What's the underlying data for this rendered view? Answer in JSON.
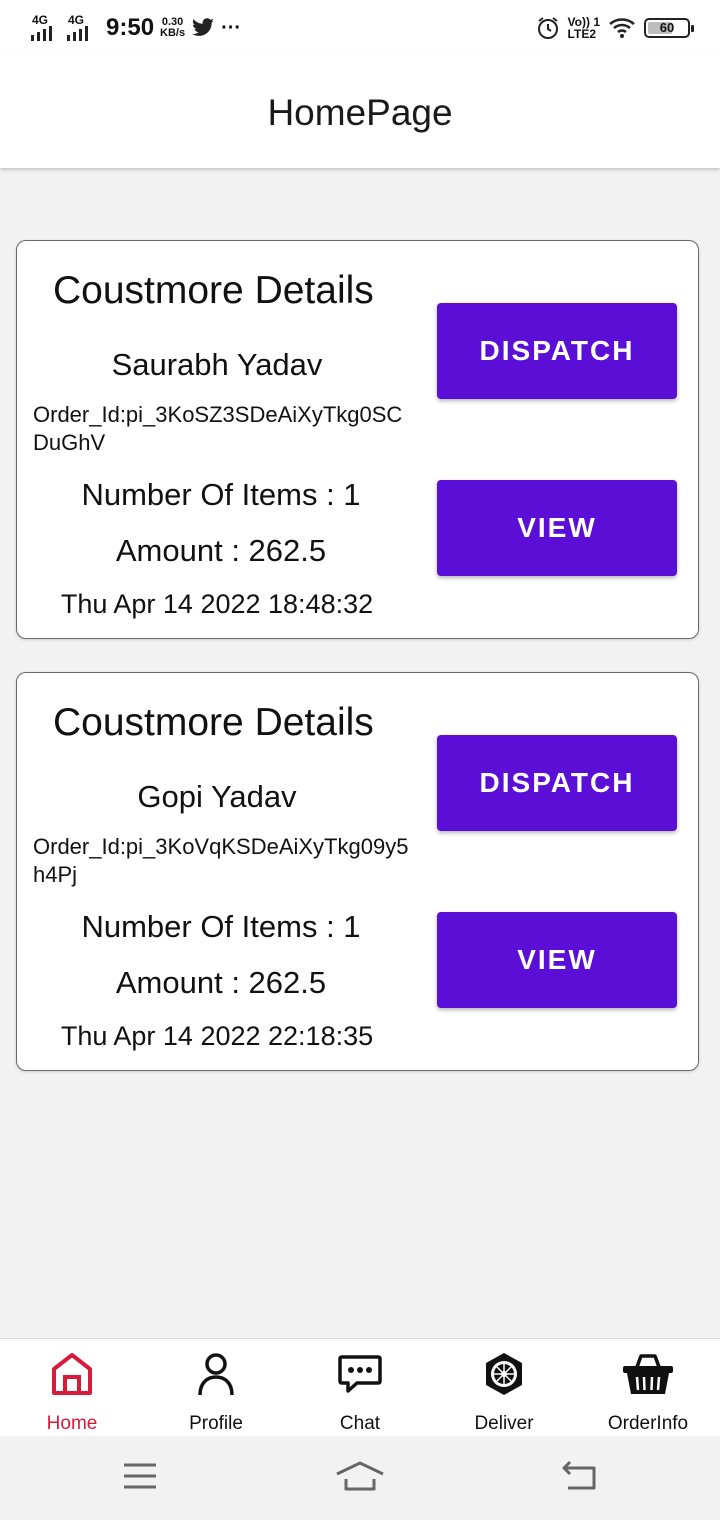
{
  "status_bar": {
    "network_1": "4G",
    "network_2": "4G",
    "time": "9:50",
    "speed_value": "0.30",
    "speed_unit": "KB/s",
    "more": "···",
    "volte_line1": "Vo)) 1",
    "volte_line2": "LTE2",
    "battery_level": "60"
  },
  "header": {
    "title": "HomePage"
  },
  "orders": [
    {
      "title": "Coustmore Details",
      "customer": "Saurabh Yadav",
      "order_id": "Order_Id:pi_3KoSZ3SDeAiXyTkg0SCDuGhV",
      "items": "Number Of Items : 1",
      "amount": "Amount : 262.5",
      "date": "Thu Apr 14 2022 18:48:32",
      "dispatch_label": "DISPATCH",
      "view_label": "VIEW"
    },
    {
      "title": "Coustmore Details",
      "customer": "Gopi Yadav",
      "order_id": "Order_Id:pi_3KoVqKSDeAiXyTkg09y5h4Pj",
      "items": "Number Of Items : 1",
      "amount": "Amount : 262.5",
      "date": "Thu Apr 14 2022 22:18:35",
      "dispatch_label": "DISPATCH",
      "view_label": "VIEW"
    }
  ],
  "bottom_nav": [
    {
      "label": "Home",
      "icon": "home-icon",
      "active": true
    },
    {
      "label": "Profile",
      "icon": "person-icon",
      "active": false
    },
    {
      "label": "Chat",
      "icon": "chat-icon",
      "active": false
    },
    {
      "label": "Deliver",
      "icon": "deliver-icon",
      "active": false
    },
    {
      "label": "OrderInfo",
      "icon": "basket-icon",
      "active": false
    }
  ],
  "colors": {
    "accent_button": "#5b0fd6",
    "active_nav": "#d81b3a",
    "background": "#f2f2f2"
  }
}
